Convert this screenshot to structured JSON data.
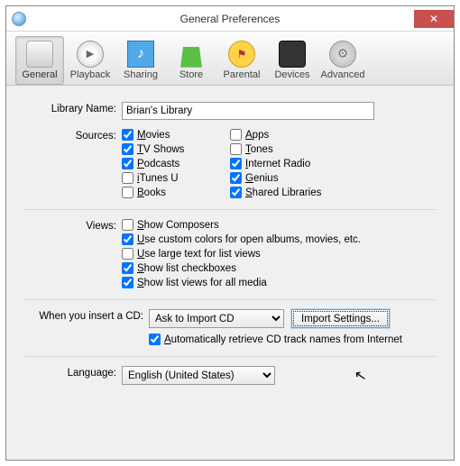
{
  "window": {
    "title": "General Preferences",
    "close": "✕"
  },
  "tabs": {
    "general": "General",
    "playback": "Playback",
    "sharing": "Sharing",
    "store": "Store",
    "parental": "Parental",
    "devices": "Devices",
    "advanced": "Advanced"
  },
  "labels": {
    "library_name": "Library Name:",
    "sources": "Sources:",
    "views": "Views:",
    "when_cd": "When you insert a CD:",
    "language": "Language:"
  },
  "library_name_value": "Brian's Library",
  "sources": {
    "movies": "Movies",
    "tv_shows": "TV Shows",
    "podcasts": "Podcasts",
    "itunes_u": "iTunes U",
    "books": "Books",
    "apps": "Apps",
    "tones": "Tones",
    "internet_radio": "Internet Radio",
    "genius": "Genius",
    "shared_libraries": "Shared Libraries"
  },
  "sources_state": {
    "movies": true,
    "tv_shows": true,
    "podcasts": true,
    "itunes_u": false,
    "books": false,
    "apps": false,
    "tones": false,
    "internet_radio": true,
    "genius": true,
    "shared_libraries": true
  },
  "views": {
    "show_composers": "Show Composers",
    "custom_colors": "Use custom colors for open albums, movies, etc.",
    "large_text": "Use large text for list views",
    "show_checkboxes": "Show list checkboxes",
    "show_list_views": "Show list views for all media"
  },
  "views_state": {
    "show_composers": false,
    "custom_colors": true,
    "large_text": false,
    "show_checkboxes": true,
    "show_list_views": true
  },
  "cd": {
    "action_selected": "Ask to Import CD",
    "import_settings": "Import Settings...",
    "auto_retrieve": "Automatically retrieve CD track names from Internet",
    "auto_retrieve_state": true
  },
  "language_selected": "English (United States)"
}
